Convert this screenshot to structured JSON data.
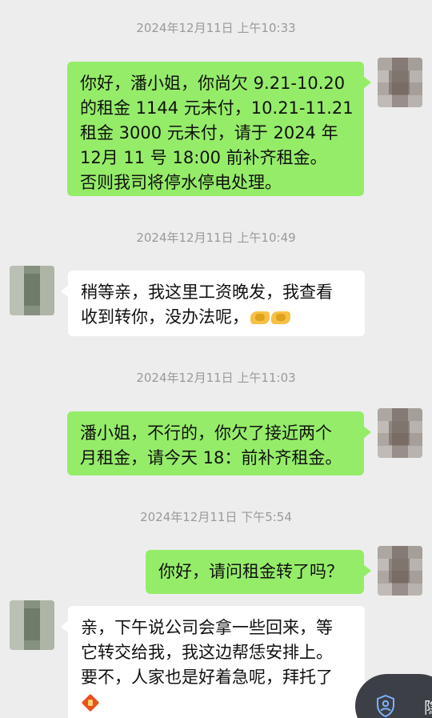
{
  "chat": {
    "messages": [
      {
        "timestamp": "2024年12月11日 上午10:33",
        "direction": "out",
        "lines": [
          "你好，潘小姐，你尚欠 9.21-10.20",
          "的租金 1144 元未付，10.21-11.21",
          "租金 3000 元未付，请于 2024 年",
          "12月 11 号 18:00 前补齐租金。",
          "否则我司将停水停电处理。"
        ]
      },
      {
        "timestamp": "2024年12月11日 上午10:49",
        "direction": "in",
        "lines": [
          "稍等亲，我这里工资晚发，我查看",
          "收到转你，没办法呢，"
        ],
        "emoji": "handshake-emoji"
      },
      {
        "timestamp": "2024年12月11日 上午11:03",
        "direction": "out",
        "lines": [
          "潘小姐，不行的，你欠了接近两个",
          "月租金，请今天 18：前补齐租金。"
        ]
      },
      {
        "timestamp": "2024年12月11日 下午5:54",
        "direction": "out",
        "lines": [
          "你好，请问租金转了吗？"
        ]
      },
      {
        "direction": "in",
        "lines": [
          "亲，下午说公司会拿一些回来，等",
          "它转交给我，我这边帮恁安排上。",
          "要不，人家也是好着急呢，拜托了"
        ],
        "emoji": "bow-emoji"
      }
    ]
  },
  "floating_button": {
    "icon": "shield-user-icon",
    "label": "隐"
  },
  "colors": {
    "background": "#ededed",
    "outgoing_bubble": "#95ec69",
    "incoming_bubble": "#ffffff",
    "timestamp": "#9a9a9a"
  }
}
